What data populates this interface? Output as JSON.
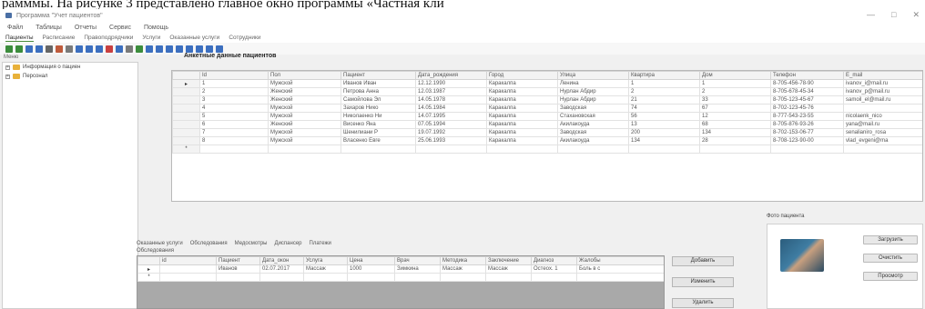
{
  "caption": "рамммы. На рисунке 3 представлено главное окно программы «Частная кли",
  "window": {
    "title": "Программа \"Учет пациентов\"",
    "controls": [
      "—",
      "□",
      "✕"
    ]
  },
  "menu": [
    "Файл",
    "Таблицы",
    "Отчеты",
    "Сервис",
    "Помощь"
  ],
  "ribbon_tabs": [
    "Пациенты",
    "Расписание",
    "Правоподрядчики",
    "Услуги",
    "Оказанные услуги",
    "Сотрудники"
  ],
  "toolbar": {
    "buttons": [
      "#3c8d3c",
      "#3c8d3c",
      "#3c6fbf",
      "#3c6fbf",
      "#666666",
      "#bf5b3c",
      "#7a7a7a",
      "#3c6fbf",
      "#3c6fbf",
      "#3c6fbf",
      "#c94040",
      "#3c6fbf",
      "#7a7a7a",
      "#3c8d3c",
      "#3c6fbf",
      "#3c6fbf",
      "#3c6fbf",
      "#3c6fbf",
      "#3c6fbf",
      "#3c6fbf",
      "#3c6fbf",
      "#3c6fbf"
    ]
  },
  "tree": {
    "header": "Меню",
    "items": [
      {
        "expander": "+",
        "label": "Информация о пациен"
      },
      {
        "expander": "+",
        "label": "Персонал"
      }
    ]
  },
  "section_title": "Анкетные данные пациентов",
  "patients": {
    "columns": [
      "",
      "Id",
      "Пол",
      "Пациент",
      "Дата_рождения",
      "Город",
      "Улица",
      "Квартира",
      "Дом",
      "Телефон",
      "E_mail"
    ],
    "rows": [
      [
        "▸",
        "1",
        "Мужской",
        "Иванов Иван",
        "12.12.1990",
        "Каракалпа",
        "Ленина",
        "1",
        "1",
        "8-705-456-78-90",
        "ivanov_i@mail.ru"
      ],
      [
        "",
        "2",
        "Женский",
        "Петрова Анна",
        "12.03.1987",
        "Каракалпа",
        "Нурлан Абдир",
        "2",
        "2",
        "8-705-678-45-34",
        "ivanov_p@mail.ru"
      ],
      [
        "",
        "3",
        "Женский",
        "Самойлова Эл",
        "14.05.1978",
        "Каракалпа",
        "Нурлан Абдир",
        "21",
        "33",
        "8-705-123-45-67",
        "samoil_el@mail.ru"
      ],
      [
        "",
        "4",
        "Мужской",
        "Захаров Нико",
        "14.05.1984",
        "Каракалпа",
        "Заводская",
        "74",
        "67",
        "8-702-123-45-76",
        ""
      ],
      [
        "",
        "5",
        "Мужской",
        "Николаенко Ни",
        "14.07.1995",
        "Каракалпа",
        "Стахановская",
        "56",
        "12",
        "8-777-543-23-55",
        "nicolaenk_nico"
      ],
      [
        "",
        "6",
        "Женский",
        "Висенко Яна",
        "07.05.1994",
        "Каракалпа",
        "Акилакоуда",
        "13",
        "68",
        "8-705-876-93-26",
        "yana@mail.ru"
      ],
      [
        "",
        "7",
        "Мужской",
        "Шенилиани Р",
        "19.07.1992",
        "Каракалпа",
        "Заводская",
        "200",
        "134",
        "8-702-153-06-77",
        "senalianiro_rosa"
      ],
      [
        "",
        "8",
        "Мужской",
        "Власенко Евге",
        "25.06.1993",
        "Каракалпа",
        "Акилакоуда",
        "134",
        "28",
        "8-708-123-90-00",
        "vlad_evgeni@ma"
      ],
      [
        "*",
        "",
        "",
        "",
        "",
        "",
        "",
        "",
        "",
        "",
        ""
      ]
    ]
  },
  "photo": {
    "label": "Фото пациента",
    "buttons": [
      "Загрузить",
      "Очистить",
      "Просмотр"
    ]
  },
  "bottom": {
    "tabs": [
      "Оказанные услуги",
      "Обследования",
      "Медосмотры",
      "Диспансер",
      "Платежи"
    ],
    "subtitle": "Обследования",
    "columns": [
      "",
      "id",
      "Пациент",
      "Дата_окон",
      "Услуга",
      "Цена",
      "Врач",
      "Методика",
      "Заключение",
      "Диагноз",
      "Жалобы"
    ],
    "rows": [
      [
        "▸",
        "1",
        "Иванов",
        "02.07.2017",
        "Массаж",
        "1000",
        "Зимкина",
        "Массаж",
        "Массаж",
        "Остеох. 1",
        "Боль в с"
      ],
      [
        "*",
        "",
        "",
        "",
        "",
        "",
        "",
        "",
        "",
        "",
        ""
      ]
    ],
    "actions": [
      "Добавить",
      "Изменить",
      "Удалить"
    ]
  }
}
